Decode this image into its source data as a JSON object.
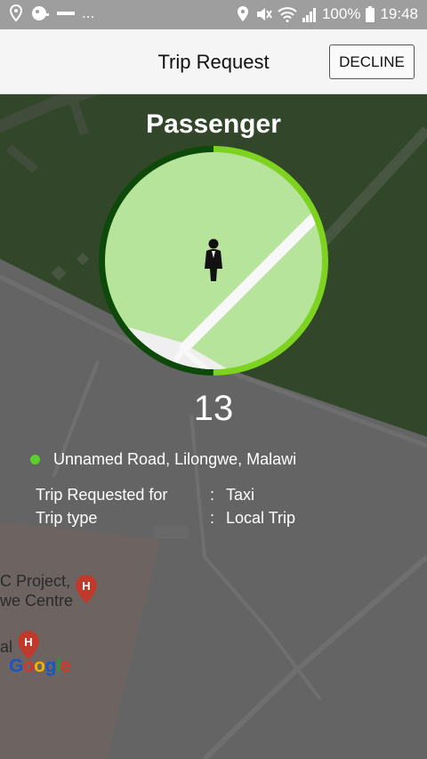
{
  "status_bar": {
    "left_dots": "...",
    "battery": "100%",
    "time": "19:48"
  },
  "app_bar": {
    "title": "Trip Request",
    "decline_label": "DECLINE"
  },
  "request": {
    "passenger_label": "Passenger",
    "countdown": "13",
    "address": "Unnamed Road, Lilongwe, Malawi",
    "details": [
      {
        "key": "Trip Requested for",
        "sep": ":",
        "value": "Taxi"
      },
      {
        "key": "Trip type",
        "sep": ":",
        "value": "Local Trip"
      }
    ],
    "timer_progress": 0.5
  },
  "map": {
    "poi_1_line1": "C Project,",
    "poi_1_line2": "we Centre",
    "poi_2": "al",
    "attribution": "Google"
  },
  "colors": {
    "ring_dark": "#0d4a0a",
    "ring_light": "#7ed321",
    "inner_fill": "#b6e49b",
    "dot": "#5cd12d",
    "map_green": "#3e5632"
  },
  "icons": {
    "passenger": "person-suit-icon",
    "hospital": "hospital-pin-icon"
  }
}
